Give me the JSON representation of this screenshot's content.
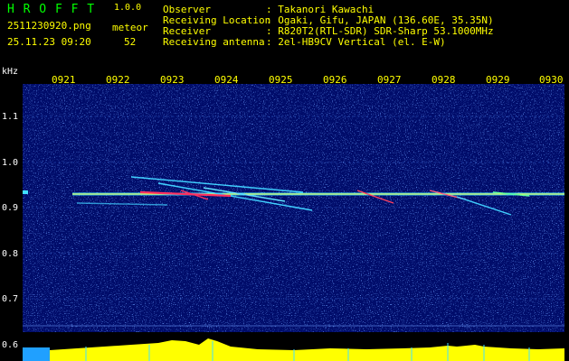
{
  "logo": {
    "text": "H R O F F T",
    "version": "1.0.0"
  },
  "file_name": "2511230920.png",
  "datetime": "25.11.23 09:20",
  "meteor": {
    "label": "meteor",
    "count": "52"
  },
  "info": [
    {
      "label": "Observer",
      "value": ": Takanori Kawachi"
    },
    {
      "label": "Receiving Location",
      "value": ": Ogaki, Gifu, JAPAN (136.60E, 35.35N)"
    },
    {
      "label": "Receiver",
      "value": ": R820T2(RTL-SDR) SDR-Sharp 53.1000MHz"
    },
    {
      "label": "Receiving antenna",
      "value": ": 2el-HB9CV Vertical (el. E-W)"
    }
  ],
  "y_axis": {
    "unit": "kHz",
    "ticks": [
      "1.1",
      "1.0",
      "0.9",
      "0.8",
      "0.7",
      "0.6"
    ]
  },
  "x_axis": {
    "ticks": [
      "0921",
      "0922",
      "0923",
      "0924",
      "0925",
      "0926",
      "0927",
      "0928",
      "0929",
      "0930"
    ]
  },
  "colors": {
    "background": "#000000",
    "label": "#ffff00",
    "logo": "#00ff00",
    "spectrogram": "#000c6a",
    "axis_text": "#ffffff",
    "signal": "#40e0ff"
  }
}
